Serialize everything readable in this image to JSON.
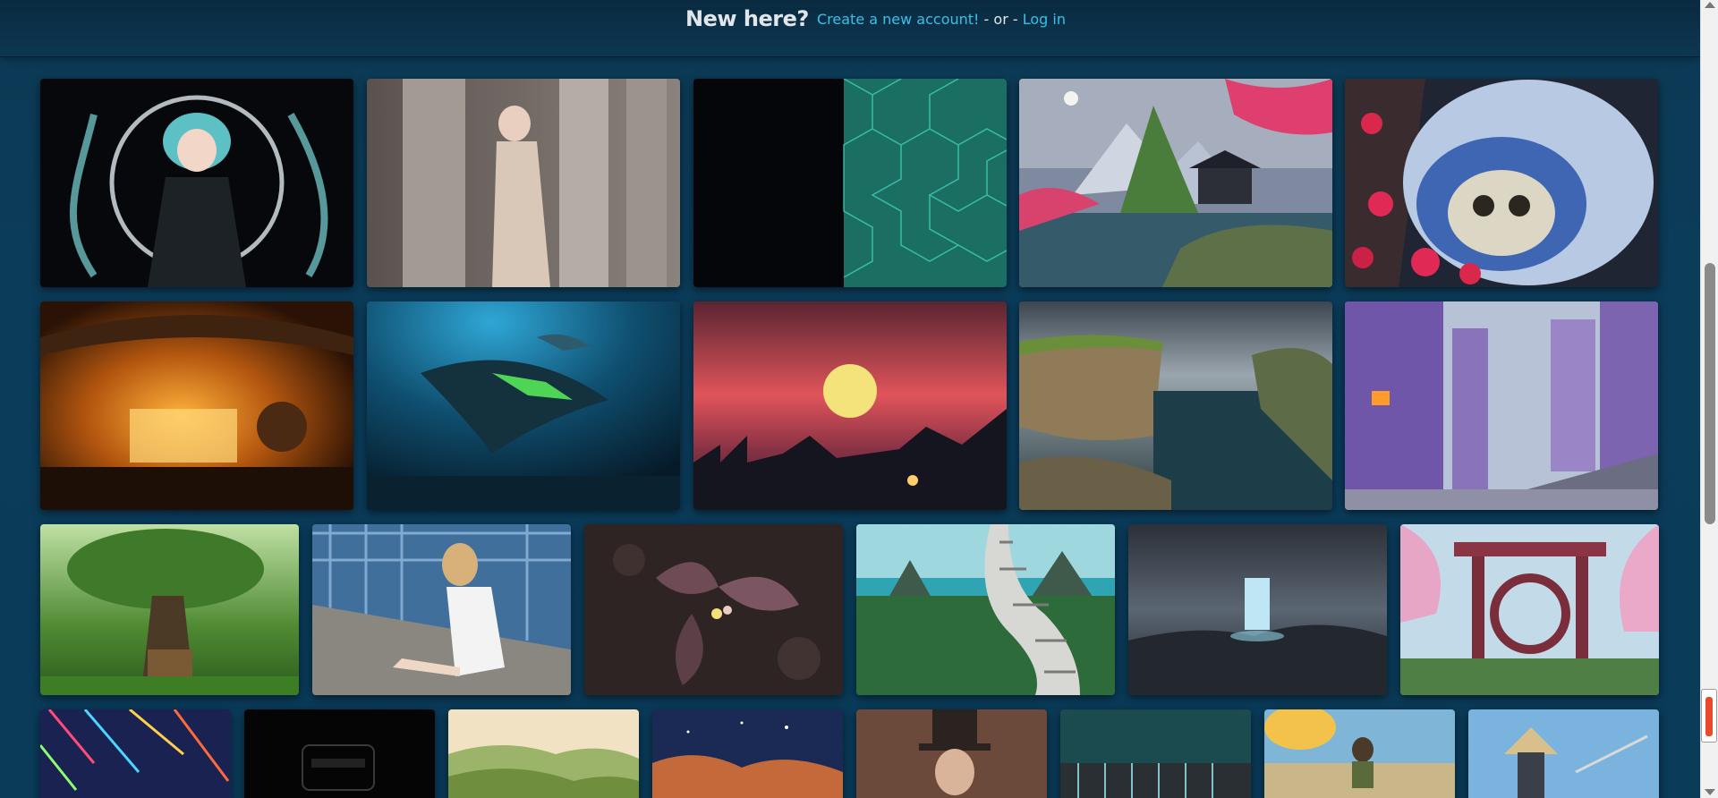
{
  "header": {
    "new_here": "New here?",
    "create_account": "Create a new account!",
    "separator": " - or - ",
    "login": "Log in"
  },
  "colors": {
    "link": "#36c1ea",
    "background": "#0b3c5a"
  }
}
